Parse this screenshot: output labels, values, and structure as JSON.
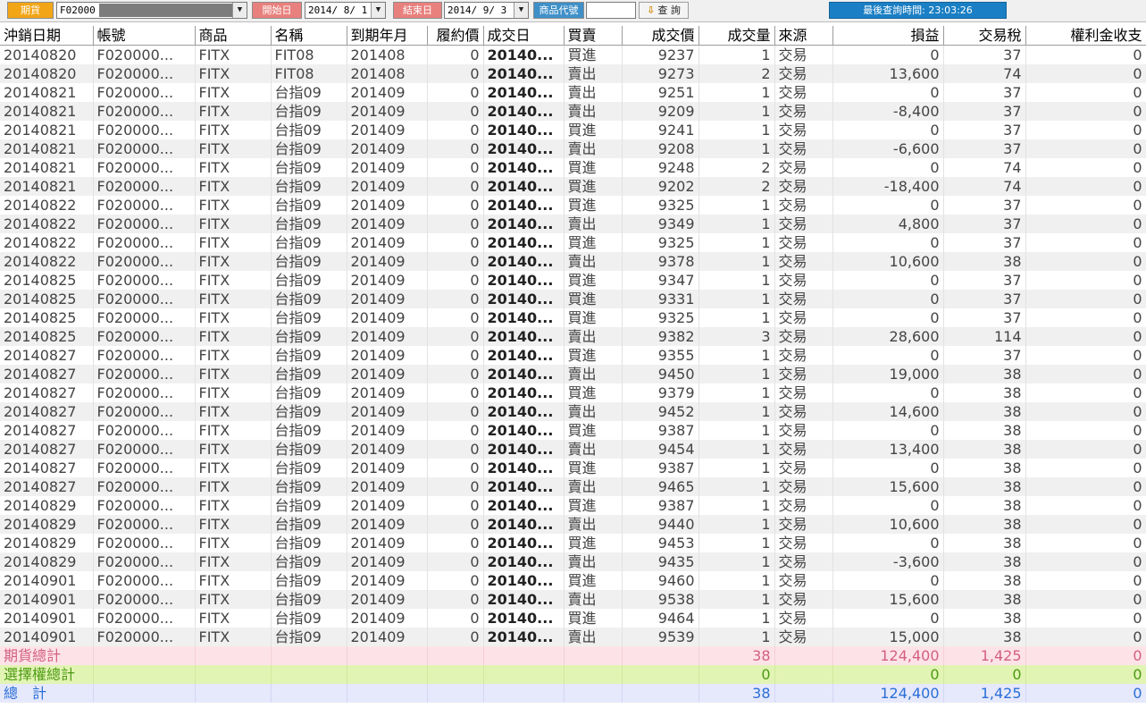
{
  "toolbar": {
    "market_label": "期貨",
    "account_value": "F02000",
    "start_label": "開始日",
    "start_value": "2014/ 8/ 1",
    "end_label": "結束日",
    "end_value": "2014/ 9/ 3",
    "code_label": "商品代號",
    "code_value": "",
    "query_label": "查 詢",
    "last_query": "最後查詢時間: 23:03:26",
    "dropdown_glyph": "▼"
  },
  "colors": {
    "market_label": "#f2a516",
    "date_label": "#e8807d",
    "code_label": "#3f90c8",
    "last_query": "#1a7fc4",
    "future_total": "#d35f83",
    "option_total": "#4c9a12",
    "grand_total": "#2a6fd6"
  },
  "icons": {
    "query": "down-arrow-icon"
  },
  "table": {
    "columns": [
      "沖銷日期",
      "帳號",
      "商品",
      "名稱",
      "到期年月",
      "履約價",
      "成交日",
      "買賣",
      "成交價",
      "成交量",
      "來源",
      "損益",
      "交易稅",
      "權利金收支"
    ],
    "rows": [
      [
        "20140820",
        "F020000...",
        "FITX",
        "FIT08",
        "201408",
        "0",
        "20140...",
        "買進",
        "9237",
        "1",
        "交易",
        "0",
        "37",
        "0"
      ],
      [
        "20140820",
        "F020000...",
        "FITX",
        "FIT08",
        "201408",
        "0",
        "20140...",
        "賣出",
        "9273",
        "2",
        "交易",
        "13,600",
        "74",
        "0"
      ],
      [
        "20140821",
        "F020000...",
        "FITX",
        "台指09",
        "201409",
        "0",
        "20140...",
        "賣出",
        "9251",
        "1",
        "交易",
        "0",
        "37",
        "0"
      ],
      [
        "20140821",
        "F020000...",
        "FITX",
        "台指09",
        "201409",
        "0",
        "20140...",
        "賣出",
        "9209",
        "1",
        "交易",
        "-8,400",
        "37",
        "0"
      ],
      [
        "20140821",
        "F020000...",
        "FITX",
        "台指09",
        "201409",
        "0",
        "20140...",
        "買進",
        "9241",
        "1",
        "交易",
        "0",
        "37",
        "0"
      ],
      [
        "20140821",
        "F020000...",
        "FITX",
        "台指09",
        "201409",
        "0",
        "20140...",
        "賣出",
        "9208",
        "1",
        "交易",
        "-6,600",
        "37",
        "0"
      ],
      [
        "20140821",
        "F020000...",
        "FITX",
        "台指09",
        "201409",
        "0",
        "20140...",
        "買進",
        "9248",
        "2",
        "交易",
        "0",
        "74",
        "0"
      ],
      [
        "20140821",
        "F020000...",
        "FITX",
        "台指09",
        "201409",
        "0",
        "20140...",
        "買進",
        "9202",
        "2",
        "交易",
        "-18,400",
        "74",
        "0"
      ],
      [
        "20140822",
        "F020000...",
        "FITX",
        "台指09",
        "201409",
        "0",
        "20140...",
        "買進",
        "9325",
        "1",
        "交易",
        "0",
        "37",
        "0"
      ],
      [
        "20140822",
        "F020000...",
        "FITX",
        "台指09",
        "201409",
        "0",
        "20140...",
        "賣出",
        "9349",
        "1",
        "交易",
        "4,800",
        "37",
        "0"
      ],
      [
        "20140822",
        "F020000...",
        "FITX",
        "台指09",
        "201409",
        "0",
        "20140...",
        "買進",
        "9325",
        "1",
        "交易",
        "0",
        "37",
        "0"
      ],
      [
        "20140822",
        "F020000...",
        "FITX",
        "台指09",
        "201409",
        "0",
        "20140...",
        "賣出",
        "9378",
        "1",
        "交易",
        "10,600",
        "38",
        "0"
      ],
      [
        "20140825",
        "F020000...",
        "FITX",
        "台指09",
        "201409",
        "0",
        "20140...",
        "買進",
        "9347",
        "1",
        "交易",
        "0",
        "37",
        "0"
      ],
      [
        "20140825",
        "F020000...",
        "FITX",
        "台指09",
        "201409",
        "0",
        "20140...",
        "買進",
        "9331",
        "1",
        "交易",
        "0",
        "37",
        "0"
      ],
      [
        "20140825",
        "F020000...",
        "FITX",
        "台指09",
        "201409",
        "0",
        "20140...",
        "買進",
        "9325",
        "1",
        "交易",
        "0",
        "37",
        "0"
      ],
      [
        "20140825",
        "F020000...",
        "FITX",
        "台指09",
        "201409",
        "0",
        "20140...",
        "賣出",
        "9382",
        "3",
        "交易",
        "28,600",
        "114",
        "0"
      ],
      [
        "20140827",
        "F020000...",
        "FITX",
        "台指09",
        "201409",
        "0",
        "20140...",
        "買進",
        "9355",
        "1",
        "交易",
        "0",
        "37",
        "0"
      ],
      [
        "20140827",
        "F020000...",
        "FITX",
        "台指09",
        "201409",
        "0",
        "20140...",
        "賣出",
        "9450",
        "1",
        "交易",
        "19,000",
        "38",
        "0"
      ],
      [
        "20140827",
        "F020000...",
        "FITX",
        "台指09",
        "201409",
        "0",
        "20140...",
        "買進",
        "9379",
        "1",
        "交易",
        "0",
        "38",
        "0"
      ],
      [
        "20140827",
        "F020000...",
        "FITX",
        "台指09",
        "201409",
        "0",
        "20140...",
        "賣出",
        "9452",
        "1",
        "交易",
        "14,600",
        "38",
        "0"
      ],
      [
        "20140827",
        "F020000...",
        "FITX",
        "台指09",
        "201409",
        "0",
        "20140...",
        "買進",
        "9387",
        "1",
        "交易",
        "0",
        "38",
        "0"
      ],
      [
        "20140827",
        "F020000...",
        "FITX",
        "台指09",
        "201409",
        "0",
        "20140...",
        "賣出",
        "9454",
        "1",
        "交易",
        "13,400",
        "38",
        "0"
      ],
      [
        "20140827",
        "F020000...",
        "FITX",
        "台指09",
        "201409",
        "0",
        "20140...",
        "買進",
        "9387",
        "1",
        "交易",
        "0",
        "38",
        "0"
      ],
      [
        "20140827",
        "F020000...",
        "FITX",
        "台指09",
        "201409",
        "0",
        "20140...",
        "賣出",
        "9465",
        "1",
        "交易",
        "15,600",
        "38",
        "0"
      ],
      [
        "20140829",
        "F020000...",
        "FITX",
        "台指09",
        "201409",
        "0",
        "20140...",
        "買進",
        "9387",
        "1",
        "交易",
        "0",
        "38",
        "0"
      ],
      [
        "20140829",
        "F020000...",
        "FITX",
        "台指09",
        "201409",
        "0",
        "20140...",
        "賣出",
        "9440",
        "1",
        "交易",
        "10,600",
        "38",
        "0"
      ],
      [
        "20140829",
        "F020000...",
        "FITX",
        "台指09",
        "201409",
        "0",
        "20140...",
        "買進",
        "9453",
        "1",
        "交易",
        "0",
        "38",
        "0"
      ],
      [
        "20140829",
        "F020000...",
        "FITX",
        "台指09",
        "201409",
        "0",
        "20140...",
        "賣出",
        "9435",
        "1",
        "交易",
        "-3,600",
        "38",
        "0"
      ],
      [
        "20140901",
        "F020000...",
        "FITX",
        "台指09",
        "201409",
        "0",
        "20140...",
        "買進",
        "9460",
        "1",
        "交易",
        "0",
        "38",
        "0"
      ],
      [
        "20140901",
        "F020000...",
        "FITX",
        "台指09",
        "201409",
        "0",
        "20140...",
        "賣出",
        "9538",
        "1",
        "交易",
        "15,600",
        "38",
        "0"
      ],
      [
        "20140901",
        "F020000...",
        "FITX",
        "台指09",
        "201409",
        "0",
        "20140...",
        "買進",
        "9464",
        "1",
        "交易",
        "0",
        "38",
        "0"
      ],
      [
        "20140901",
        "F020000...",
        "FITX",
        "台指09",
        "201409",
        "0",
        "20140...",
        "賣出",
        "9539",
        "1",
        "交易",
        "15,000",
        "38",
        "0"
      ]
    ],
    "summary": [
      {
        "label": "期貨總計",
        "qty": "38",
        "pnl": "124,400",
        "tax": "1,425",
        "premium": "0"
      },
      {
        "label": "選擇權總計",
        "qty": "0",
        "pnl": "0",
        "tax": "0",
        "premium": "0"
      },
      {
        "label": "總　計",
        "qty": "38",
        "pnl": "124,400",
        "tax": "1,425",
        "premium": "0"
      }
    ]
  }
}
